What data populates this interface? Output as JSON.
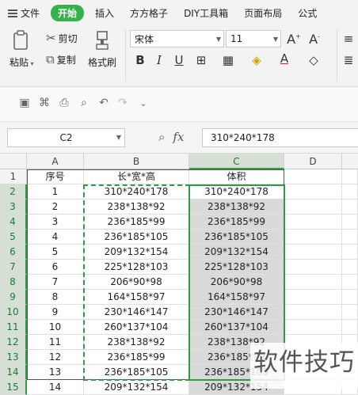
{
  "menu": {
    "items": [
      "文件",
      "开始",
      "插入",
      "方方格子",
      "DIY工具箱",
      "页面布局",
      "公式"
    ],
    "active": "开始"
  },
  "ribbon": {
    "paste_label": "粘贴",
    "cut_label": "剪切",
    "copy_label": "复制",
    "format_painter_label": "格式刷",
    "font_name": "宋体",
    "font_size": "11"
  },
  "formula_bar": {
    "name_box": "C2",
    "fx_label": "fx",
    "formula": "310*240*178"
  },
  "sheet": {
    "columns": [
      "A",
      "B",
      "C",
      "D"
    ],
    "selected_column": "C",
    "rows": [
      "1",
      "2",
      "3",
      "4",
      "5",
      "6",
      "7",
      "8",
      "9",
      "10",
      "11",
      "12",
      "13",
      "14",
      "15"
    ],
    "header": {
      "a": "序号",
      "b": "长*宽*高",
      "c": "体积"
    },
    "data": [
      {
        "a": "1",
        "b": "310*240*178",
        "c": "310*240*178"
      },
      {
        "a": "2",
        "b": "238*138*92",
        "c": "238*138*92"
      },
      {
        "a": "3",
        "b": "236*185*99",
        "c": "236*185*99"
      },
      {
        "a": "4",
        "b": "236*185*105",
        "c": "236*185*105"
      },
      {
        "a": "5",
        "b": "209*132*154",
        "c": "209*132*154"
      },
      {
        "a": "6",
        "b": "225*128*103",
        "c": "225*128*103"
      },
      {
        "a": "7",
        "b": "206*90*98",
        "c": "206*90*98"
      },
      {
        "a": "8",
        "b": "164*158*97",
        "c": "164*158*97"
      },
      {
        "a": "9",
        "b": "230*146*147",
        "c": "230*146*147"
      },
      {
        "a": "10",
        "b": "260*137*104",
        "c": "260*137*104"
      },
      {
        "a": "11",
        "b": "238*138*92",
        "c": "238*138*92"
      },
      {
        "a": "12",
        "b": "236*185*99",
        "c": "236*185*99"
      },
      {
        "a": "13",
        "b": "236*185*105",
        "c": "236*185*105"
      },
      {
        "a": "14",
        "b": "209*132*154",
        "c": "209*132*154"
      }
    ]
  },
  "watermark": "软件技巧"
}
